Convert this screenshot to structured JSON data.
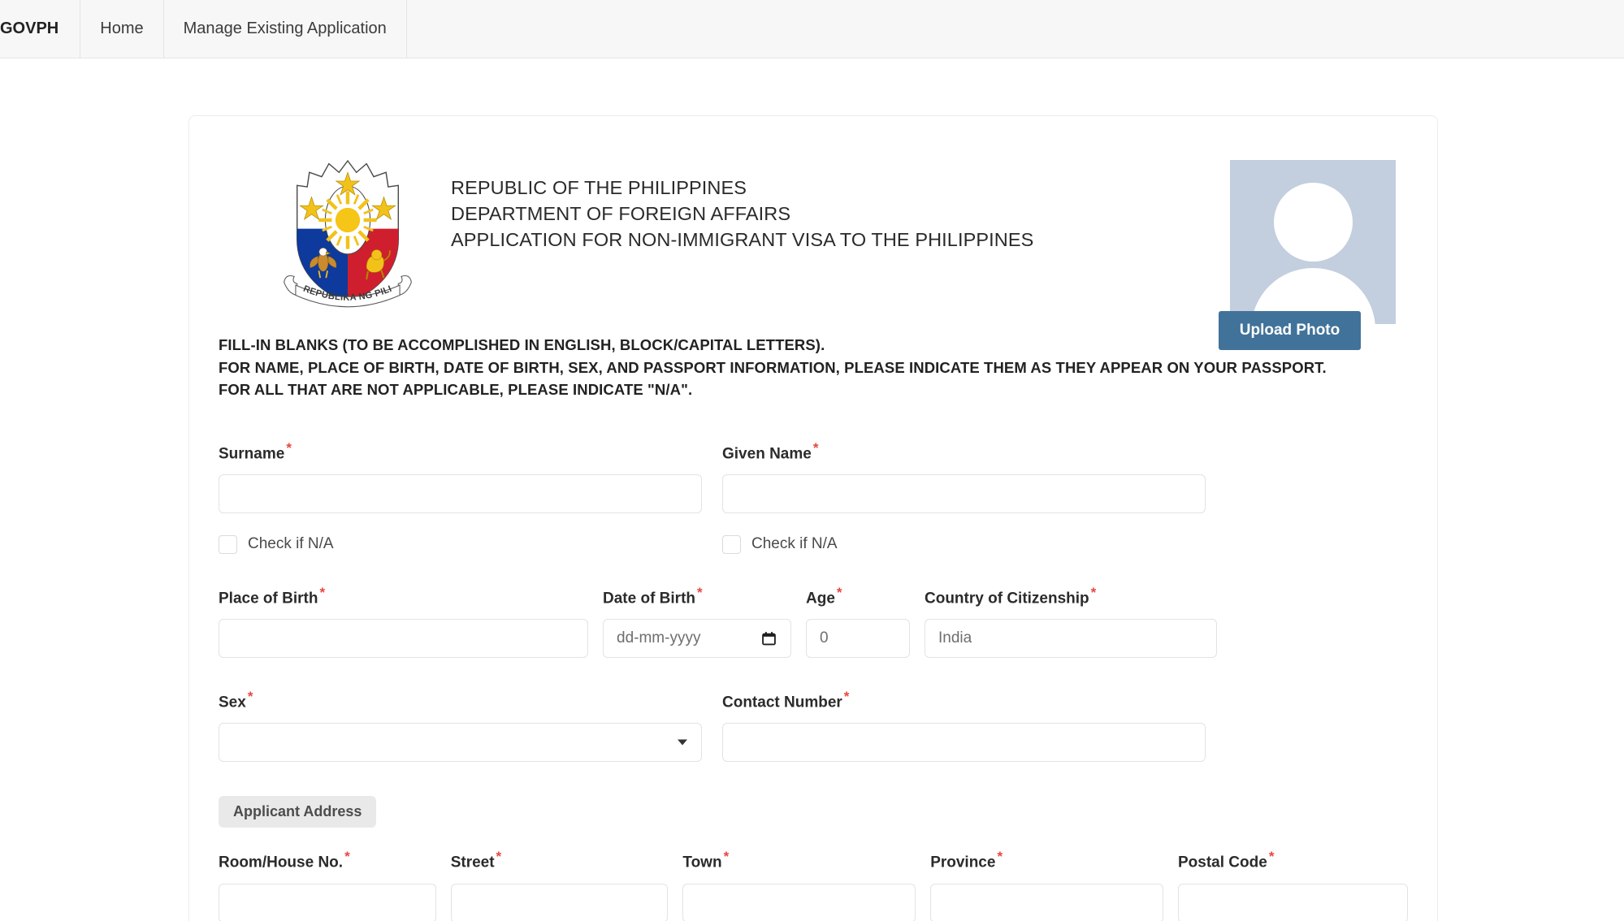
{
  "navbar": {
    "brand": "GOVPH",
    "items": [
      {
        "label": "Home"
      },
      {
        "label": "Manage Existing Application"
      }
    ]
  },
  "header": {
    "emblem_caption": "REPUBLIKA NG PILIPINAS",
    "line1": "REPUBLIC OF THE PHILIPPINES",
    "line2": "DEPARTMENT OF FOREIGN AFFAIRS",
    "line3": "APPLICATION FOR NON-IMMIGRANT VISA TO THE PHILIPPINES",
    "upload_button": "Upload Photo"
  },
  "instructions": {
    "line1": "FILL-IN BLANKS (TO BE ACCOMPLISHED IN ENGLISH, BLOCK/CAPITAL LETTERS).",
    "line2": "FOR NAME, PLACE OF BIRTH, DATE OF BIRTH, SEX, AND PASSPORT INFORMATION, PLEASE INDICATE THEM AS THEY APPEAR ON YOUR PASSPORT.",
    "line3": "FOR ALL THAT ARE NOT APPLICABLE, PLEASE INDICATE \"N/A\"."
  },
  "form": {
    "required_marker": "*",
    "surname": {
      "label": "Surname",
      "value": "",
      "placeholder": ""
    },
    "given_name": {
      "label": "Given Name",
      "value": "",
      "placeholder": ""
    },
    "na_checkbox_surname": {
      "label": "Check if N/A",
      "checked": false
    },
    "na_checkbox_given": {
      "label": "Check if N/A",
      "checked": false
    },
    "place_of_birth": {
      "label": "Place of Birth",
      "value": "",
      "placeholder": ""
    },
    "date_of_birth": {
      "label": "Date of Birth",
      "value": "",
      "placeholder": "dd-mm-yyyy"
    },
    "age": {
      "label": "Age",
      "value": "0",
      "placeholder": "0"
    },
    "country_of_citizenship": {
      "label": "Country of Citizenship",
      "value": "India",
      "placeholder": "India"
    },
    "sex": {
      "label": "Sex",
      "value": "",
      "selected": ""
    },
    "contact_number": {
      "label": "Contact Number",
      "value": "",
      "placeholder": ""
    },
    "applicant_address_section": "Applicant Address",
    "room_house_no": {
      "label": "Room/House No.",
      "value": "",
      "placeholder": ""
    },
    "street": {
      "label": "Street",
      "value": "",
      "placeholder": ""
    },
    "town": {
      "label": "Town",
      "value": "",
      "placeholder": ""
    },
    "province": {
      "label": "Province",
      "value": "",
      "placeholder": ""
    },
    "postal_code": {
      "label": "Postal Code",
      "value": "",
      "placeholder": ""
    }
  },
  "colors": {
    "navbar_bg": "#f7f7f7",
    "upload_button": "#41729a",
    "avatar_bg": "#c3cede",
    "required_red": "#e8463f",
    "section_pill_bg": "#e9e9e9",
    "input_border": "#e3e3e3"
  }
}
